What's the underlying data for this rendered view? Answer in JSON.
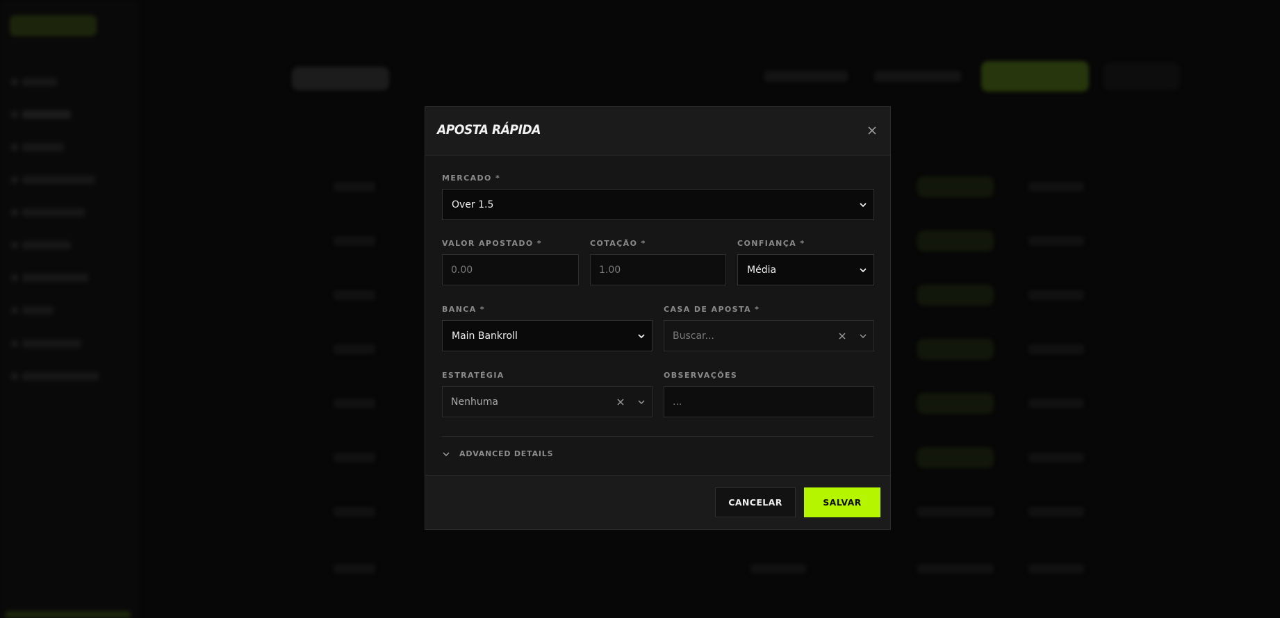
{
  "modal": {
    "title": "APOSTA RÁPIDA",
    "fields": {
      "market": {
        "label": "MERCADO *",
        "value": "Over 1.5"
      },
      "stake": {
        "label": "VALOR APOSTADO *",
        "placeholder": "0.00"
      },
      "odds": {
        "label": "COTAÇÃO *",
        "placeholder": "1.00"
      },
      "confidence": {
        "label": "CONFIANÇA *",
        "value": "Média"
      },
      "bank": {
        "label": "BANCA *",
        "value": "Main Bankroll"
      },
      "bookmaker": {
        "label": "CASA DE APOSTA *",
        "placeholder": "Buscar..."
      },
      "strategy": {
        "label": "ESTRATÉGIA",
        "value": "Nenhuma"
      },
      "notes": {
        "label": "OBSERVAÇÕES",
        "placeholder": "..."
      }
    },
    "advanced_label": "ADVANCED DETAILS",
    "cancel_label": "CANCELAR",
    "save_label": "SALVAR"
  },
  "colors": {
    "accent": "#b6f500",
    "background": "#0b0b0b",
    "modal": "#161616",
    "input": "#0d0d0d"
  },
  "icons": [
    "close-icon",
    "chevron-down-icon",
    "clear-icon"
  ]
}
